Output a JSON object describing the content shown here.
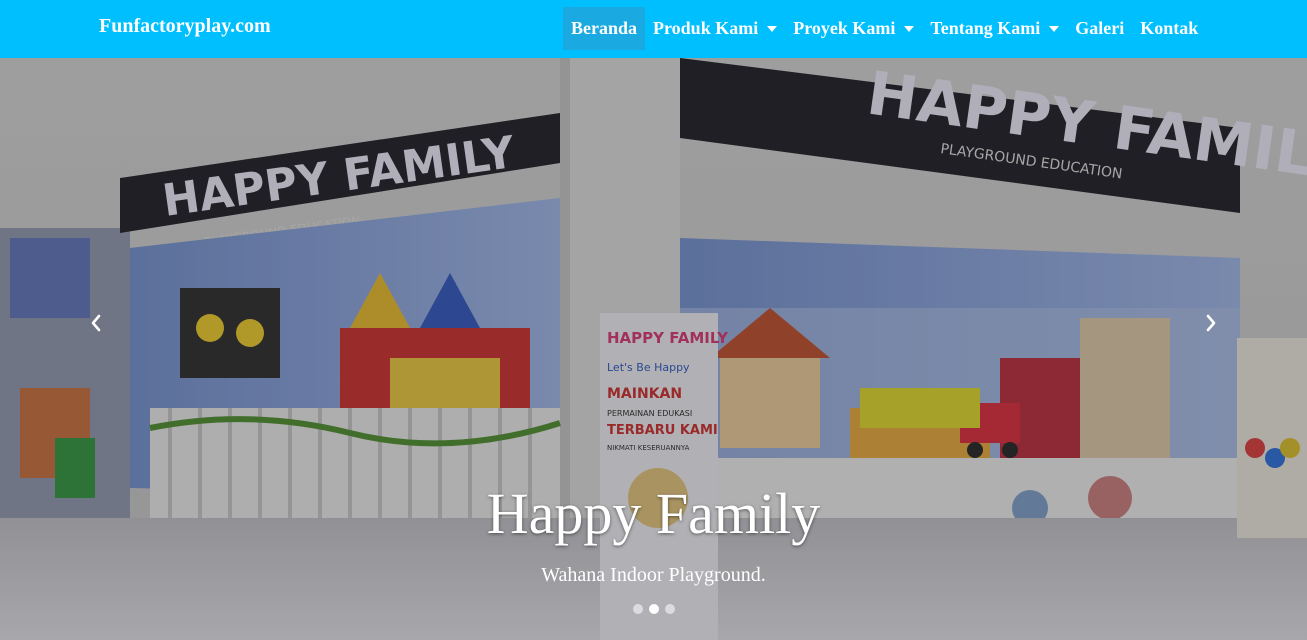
{
  "navbar": {
    "brand": "Funfactoryplay.com",
    "bg_color": "#00bfff",
    "items": [
      {
        "label": "Beranda",
        "active": true,
        "dropdown": false
      },
      {
        "label": "Produk Kami",
        "active": false,
        "dropdown": true
      },
      {
        "label": "Proyek Kami",
        "active": false,
        "dropdown": true
      },
      {
        "label": "Tentang Kami",
        "active": false,
        "dropdown": true
      },
      {
        "label": "Galeri",
        "active": false,
        "dropdown": false
      },
      {
        "label": "Kontak",
        "active": false,
        "dropdown": false
      }
    ]
  },
  "carousel": {
    "slide": {
      "store_sign_left": "HAPPY FAMILY",
      "store_sign_sub": "PLAYGROUND EDUCATION",
      "store_sign_right": "HAPPY FAMILY",
      "banner_title": "HAPPY FAMILY",
      "banner_tagline": "Let's Be Happy",
      "banner_text_1": "MAINKAN",
      "banner_text_2": "PERMAINAN EDUKASI",
      "banner_text_3": "TERBARU KAMI",
      "banner_text_4": "NIKMATI KESERUANNYA"
    },
    "caption_title": "Happy Family",
    "caption_text": "Wahana Indoor Playground.",
    "prev_icon": "chevron-left-icon",
    "next_icon": "chevron-right-icon",
    "indicator_count": 3,
    "active_indicator": 1
  }
}
